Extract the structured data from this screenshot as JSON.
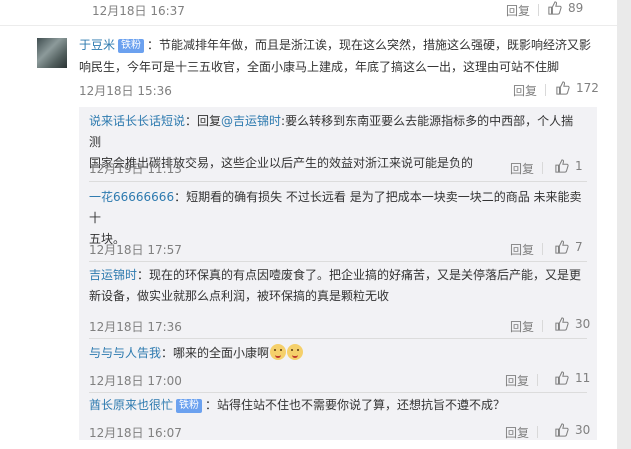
{
  "top": {
    "time": "12月18日 16:37",
    "reply": "回复",
    "likes": "89"
  },
  "comment": {
    "user": "于豆米",
    "badge": "铁粉",
    "text_line1": "：节能减排年年做，而且是浙江诶，现在这么突然，措施这么强硬，既影响经济又影",
    "text_line2": "响民生，今年可是十三五收官，全面小康马上建成，年底了搞这么一出，这理由可站不住脚",
    "time": "12月18日 15:36",
    "reply": "回复",
    "likes": "172"
  },
  "replies": [
    {
      "user": "说来话长长话短说",
      "text_prefix": "：回复",
      "mention": "@吉运锦时",
      "text_line1": ":要么转移到东南亚要么去能源指标多的中西部，个人揣测",
      "text_line2": "国家会推出碳排放交易，这些企业以后产生的效益对浙江来说可能是负的",
      "time": "12月19日 11:13",
      "reply": "回复",
      "likes": "1"
    },
    {
      "user": "一花66666666",
      "text_line1": "：短期看的确有损失 不过长远看 是为了把成本一块卖一块二的商品 未来能卖十",
      "text_line2": "五块。",
      "time": "12月18日 17:57",
      "reply": "回复",
      "likes": "7"
    },
    {
      "user": "吉运锦时",
      "text_line1": "：现在的环保真的有点因噎废食了。把企业搞的好痛苦，又是关停落后产能，又是更",
      "text_line2": "新设备，做实业就那么点利润，被环保搞的真是颗粒无收",
      "time": "12月18日 17:36",
      "reply": "回复",
      "likes": "30"
    },
    {
      "user": "与与与人告我",
      "text_line1": "：哪来的全面小康啊",
      "emoji_names": [
        "smiley-face-icon",
        "smiley-face-icon"
      ],
      "time": "12月18日 17:00",
      "reply": "回复",
      "likes": "11"
    },
    {
      "user": "酋长原来也很忙",
      "badge": "铁粉",
      "text_line1": "：站得住站不住也不需要你说了算，还想抗旨不遵不成？",
      "time": "12月18日 16:07",
      "reply": "回复",
      "likes": "30"
    }
  ],
  "colors": {
    "link": "#2d7aaf",
    "badge": "#6ba1ef",
    "muted": "#808080"
  }
}
